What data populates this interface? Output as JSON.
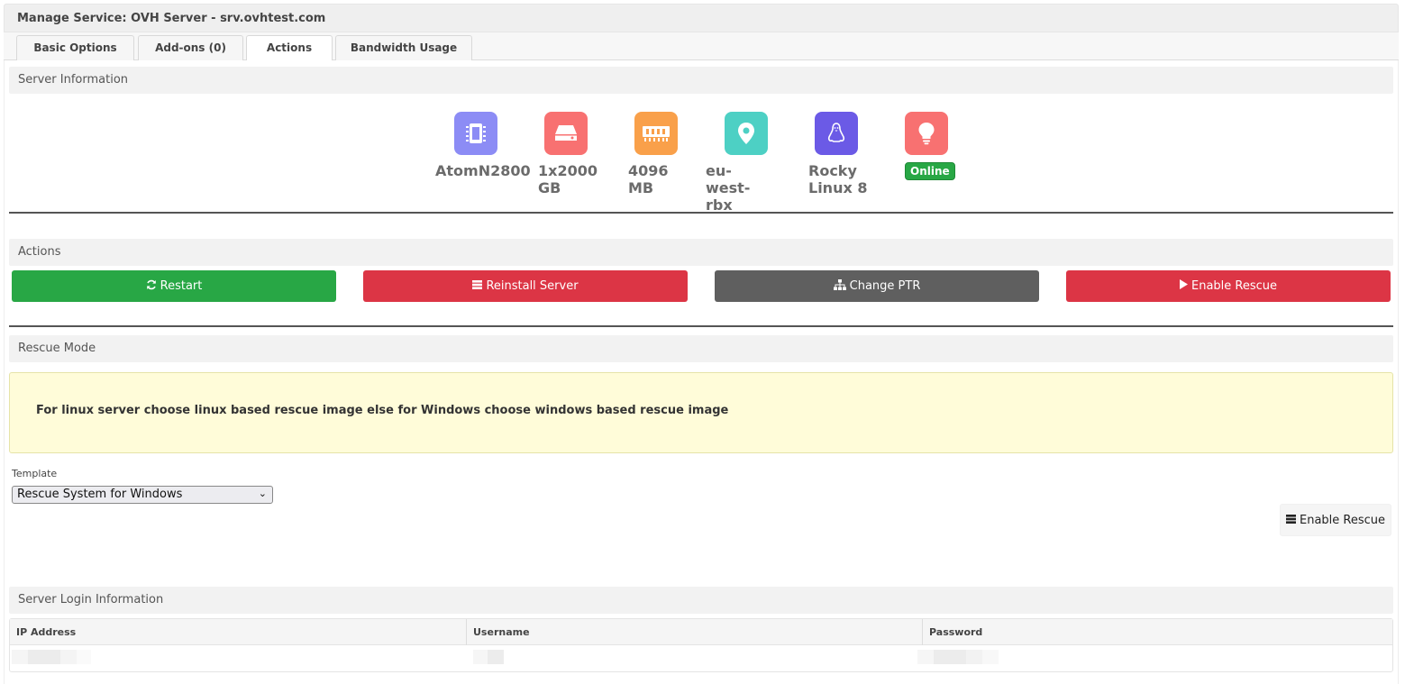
{
  "page": {
    "title": "Manage Service: OVH Server - srv.ovhtest.com"
  },
  "tabs": [
    {
      "label": "Basic Options"
    },
    {
      "label": "Add-ons (0)"
    },
    {
      "label": "Actions"
    },
    {
      "label": "Bandwidth Usage"
    }
  ],
  "active_tab": "Actions",
  "server_info": {
    "heading": "Server Information",
    "items": [
      {
        "icon": "cpu-icon",
        "color": "#8c8cf5",
        "value_lines": [
          "AtomN2800"
        ]
      },
      {
        "icon": "hard-drive-icon",
        "color": "#f87171",
        "value_lines": [
          "1x2000",
          "GB"
        ]
      },
      {
        "icon": "memory-icon",
        "color": "#f9a04a",
        "value_lines": [
          "4096",
          "MB"
        ]
      },
      {
        "icon": "map-pin-icon",
        "color": "#4dd0c4",
        "value_lines": [
          "eu-",
          "west-",
          "rbx"
        ]
      },
      {
        "icon": "linux-icon",
        "color": "#6b5ae6",
        "value_lines": [
          "Rocky",
          "Linux 8"
        ]
      },
      {
        "icon": "lightbulb-icon",
        "color": "#f87171",
        "status": "Online",
        "status_color": "#28a745"
      }
    ]
  },
  "actions": {
    "heading": "Actions",
    "buttons": [
      {
        "label": "Restart",
        "icon": "refresh-icon",
        "color": "#28a745"
      },
      {
        "label": "Reinstall Server",
        "icon": "server-icon",
        "color": "#dc3545"
      },
      {
        "label": "Change PTR",
        "icon": "sitemap-icon",
        "color": "#5f5f5f"
      },
      {
        "label": "Enable Rescue",
        "icon": "play-icon",
        "color": "#dc3545"
      }
    ]
  },
  "rescue": {
    "heading": "Rescue Mode",
    "notice": "For linux server choose linux based rescue image else for Windows choose windows based rescue image",
    "template_label": "Template",
    "template_value": "Rescue System for Windows",
    "enable_label": "Enable Rescue"
  },
  "login": {
    "heading": "Server Login Information",
    "columns": [
      "IP Address",
      "Username",
      "Password"
    ]
  }
}
